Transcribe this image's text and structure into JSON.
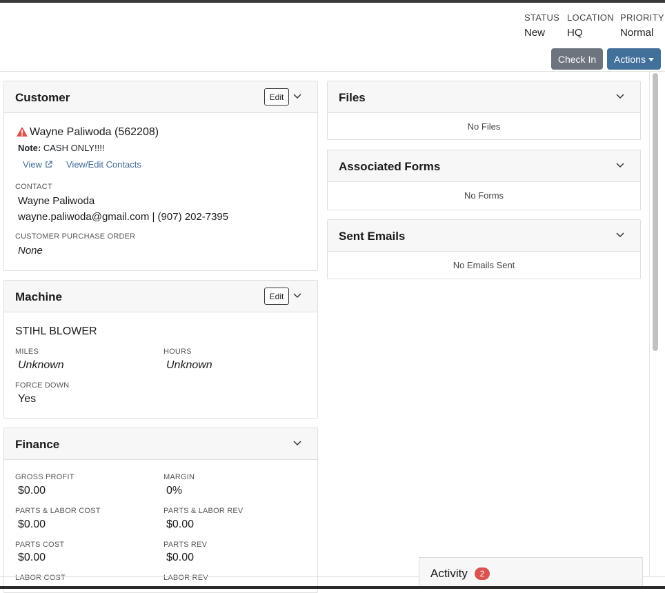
{
  "header": {
    "status": {
      "label": "STATUS",
      "value": "New"
    },
    "location": {
      "label": "LOCATION",
      "value": "HQ"
    },
    "priority": {
      "label": "PRIORITY",
      "value": "Normal"
    },
    "checkin_label": "Check In",
    "actions_label": "Actions"
  },
  "customer": {
    "title": "Customer",
    "edit_label": "Edit",
    "name": "Wayne Paliwoda (562208)",
    "note_label": "Note:",
    "note_text": "CASH ONLY!!!!",
    "view_label": "View",
    "view_edit_contacts_label": "View/Edit Contacts",
    "contact_label": "CONTACT",
    "contact_name": "Wayne Paliwoda",
    "contact_details": "wayne.paliwoda@gmail.com | (907) 202-7395",
    "po_label": "CUSTOMER PURCHASE ORDER",
    "po_value": "None"
  },
  "machine": {
    "title": "Machine",
    "edit_label": "Edit",
    "name": "STIHL BLOWER",
    "miles_label": "MILES",
    "miles_value": "Unknown",
    "hours_label": "HOURS",
    "hours_value": "Unknown",
    "force_down_label": "FORCE DOWN",
    "force_down_value": "Yes"
  },
  "finance": {
    "title": "Finance",
    "gross_profit_label": "GROSS PROFIT",
    "gross_profit_value": "$0.00",
    "margin_label": "MARGIN",
    "margin_value": "0%",
    "pl_cost_label": "PARTS & LABOR COST",
    "pl_cost_value": "$0.00",
    "pl_rev_label": "PARTS & LABOR REV",
    "pl_rev_value": "$0.00",
    "parts_cost_label": "PARTS COST",
    "parts_cost_value": "$0.00",
    "parts_rev_label": "PARTS REV",
    "parts_rev_value": "$0.00",
    "labor_cost_label": "LABOR COST",
    "labor_rev_label": "LABOR REV"
  },
  "files": {
    "title": "Files",
    "empty": "No Files"
  },
  "forms": {
    "title": "Associated Forms",
    "empty": "No Forms"
  },
  "emails": {
    "title": "Sent Emails",
    "empty": "No Emails Sent"
  },
  "activity": {
    "title": "Activity",
    "count": "2"
  },
  "colors": {
    "primary": "#41709b",
    "secondary": "#6c757d",
    "danger": "#d9534f"
  },
  "icons": [
    "warning-icon",
    "external-link-icon",
    "chevron-down-icon",
    "caret-down-icon"
  ]
}
